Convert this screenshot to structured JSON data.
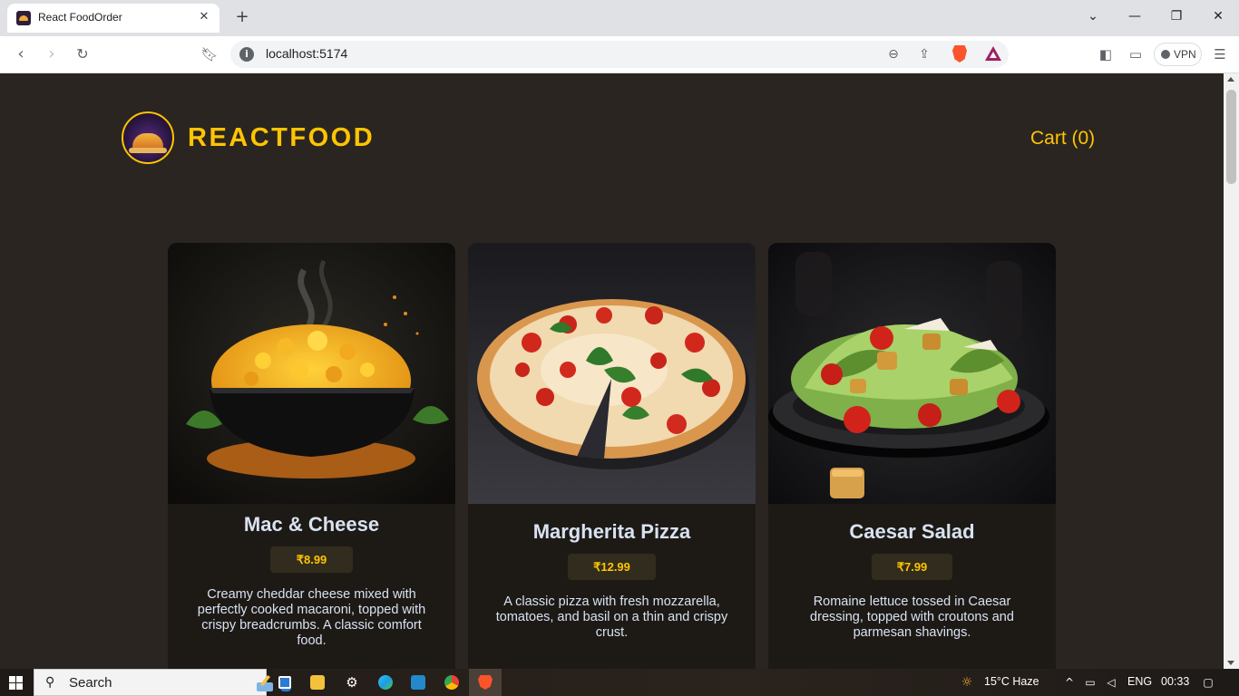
{
  "browser": {
    "tab_title": "React FoodOrder",
    "tab_close_icon": "close-icon",
    "new_tab_icon": "plus-icon",
    "url": "localhost:5174",
    "vpn_label": "VPN",
    "window_controls": [
      "minimize-icon",
      "restore-icon",
      "close-icon"
    ]
  },
  "header": {
    "brand": "REACTFOOD",
    "cart_label": "Cart (0)"
  },
  "meals": [
    {
      "name": "Mac & Cheese",
      "price": "₹8.99",
      "description": "Creamy cheddar cheese mixed with perfectly cooked macaroni, topped with crispy breadcrumbs. A classic comfort food."
    },
    {
      "name": "Margherita Pizza",
      "price": "₹12.99",
      "description": "A classic pizza with fresh mozzarella, tomatoes, and basil on a thin and crispy crust."
    },
    {
      "name": "Caesar Salad",
      "price": "₹7.99",
      "description": "Romaine lettuce tossed in Caesar dressing, topped with croutons and parmesan shavings."
    }
  ],
  "taskbar": {
    "search_label": "Search",
    "weather": "15°C  Haze",
    "language": "ENG",
    "time": "00:33"
  },
  "colors": {
    "accent": "#ffc404",
    "page_background": "#2a2520",
    "card_background": "#1d1a16",
    "text_light": "#d9e2f1"
  }
}
